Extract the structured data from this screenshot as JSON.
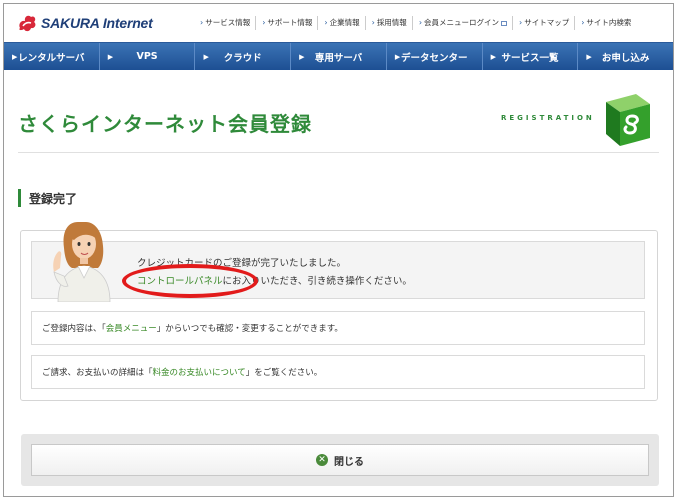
{
  "header": {
    "logo_text": "SAKURA Internet",
    "links": [
      "サービス情報",
      "サポート情報",
      "企業情報",
      "採用情報",
      "会員メニューログイン",
      "サイトマップ",
      "サイト内検索"
    ]
  },
  "nav": {
    "items": [
      "レンタルサーバ",
      "VPS",
      "クラウド",
      "専用サーバ",
      "データセンター",
      "サービス一覧",
      "お申し込み"
    ]
  },
  "title": {
    "page_title": "さくらインターネット会員登録",
    "registration": "REGISTRATION"
  },
  "section": {
    "heading": "登録完了"
  },
  "message": {
    "line1": "クレジットカードのご登録が完了いたしました。",
    "link_control_panel": "コントロールパネル",
    "line2_rest": "にお入りいただき、引き続き操作ください。"
  },
  "info1": {
    "prefix": "ご登録内容は、「",
    "link": "会員メニュー",
    "suffix": "」からいつでも確認・変更することができます。"
  },
  "info2": {
    "prefix": "ご請求、お支払いの詳細は「",
    "link": "料金のお支払いについて",
    "suffix": "」をご覧ください。"
  },
  "close_button": {
    "label": "閉じる",
    "icon": "close-circle-icon"
  },
  "colors": {
    "brand_green": "#2f8a3a",
    "nav_blue": "#1d4f93",
    "highlight_red": "#e21b1b"
  }
}
